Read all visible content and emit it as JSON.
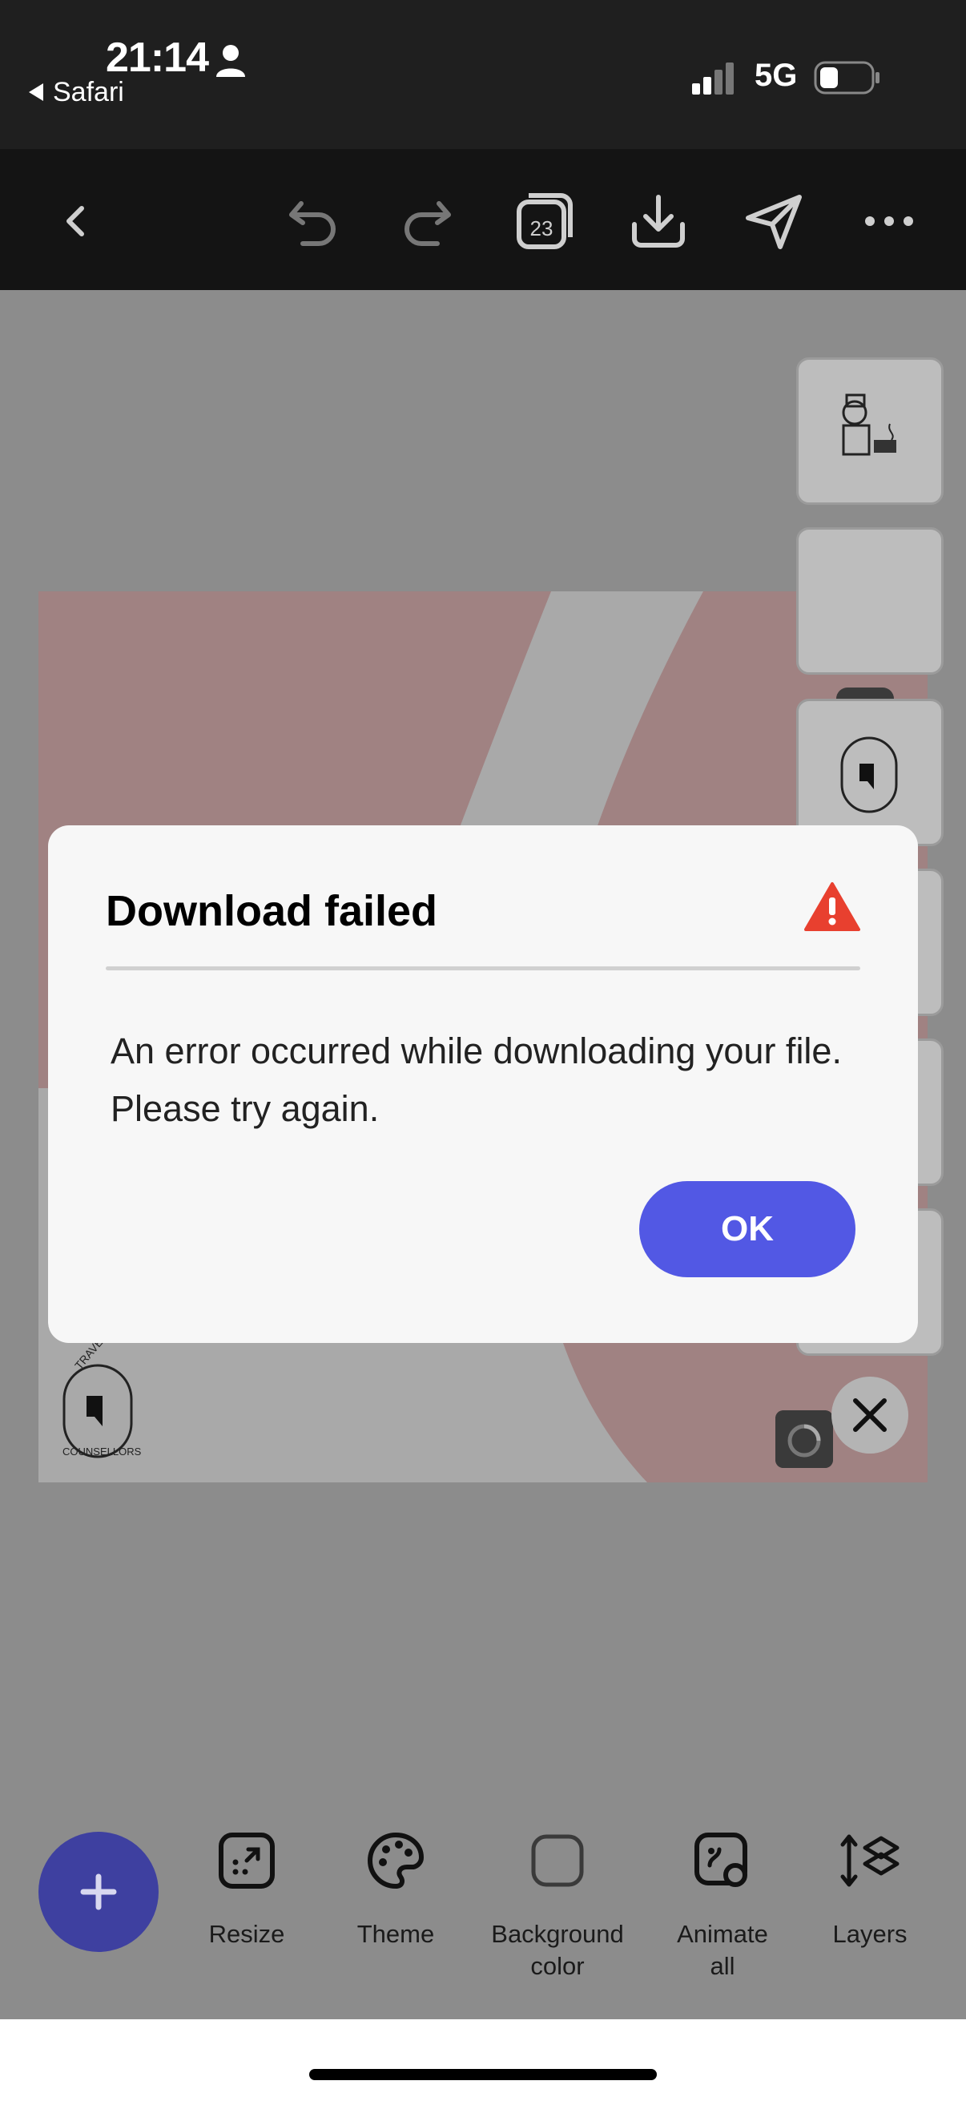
{
  "status_bar": {
    "time": "21:14",
    "back_app": "Safari",
    "network": "5G"
  },
  "dialog": {
    "title": "Download failed",
    "message_line1": "An error occurred while downloading your file.",
    "message_line2": "Please try again.",
    "ok_label": "OK"
  },
  "toolbar": {
    "pages_count": "23"
  },
  "bottom_tools": {
    "resize": "Resize",
    "theme": "Theme",
    "background_color_line1": "Background",
    "background_color_line2": "color",
    "animate_all_line1": "Animate",
    "animate_all_line2": "all",
    "layers": "Layers"
  },
  "logo": {
    "text_top": "TRAVEL",
    "text_bottom": "COUNSELLORS"
  },
  "colors": {
    "accent_button": "#5258e4",
    "fab": "#3e40a0",
    "alert_red": "#e8402f",
    "canvas_pink": "#a08282"
  }
}
